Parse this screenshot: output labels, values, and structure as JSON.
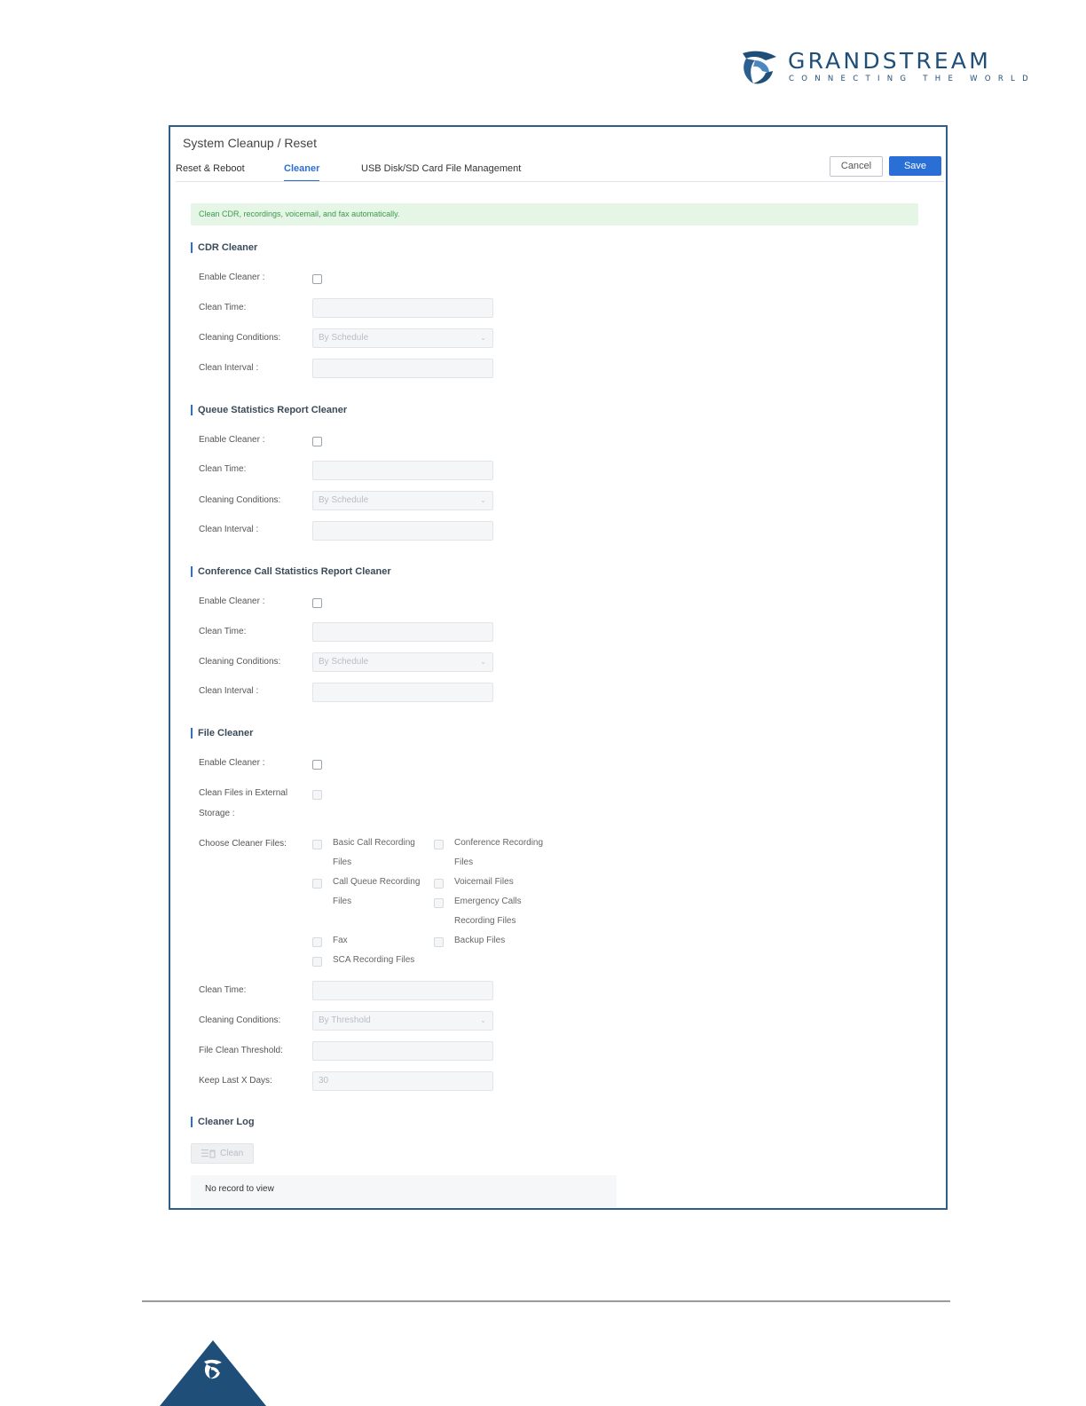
{
  "brand": {
    "name": "GRANDSTREAM",
    "tagline": "CONNECTING THE WORLD",
    "colors": {
      "primary": "#1f4e79",
      "accent": "#2a6fd6"
    }
  },
  "page": {
    "title": "System Cleanup / Reset",
    "tabs": [
      {
        "label": "Reset & Reboot",
        "active": false
      },
      {
        "label": "Cleaner",
        "active": true
      },
      {
        "label": "USB Disk/SD Card File Management",
        "active": false
      }
    ],
    "buttons": {
      "cancel": "Cancel",
      "save": "Save"
    },
    "info": "Clean CDR, recordings, voicemail, and fax automatically."
  },
  "sections": {
    "cdr": {
      "title": "CDR Cleaner",
      "enable_label": "Enable Cleaner :",
      "clean_time_label": "Clean Time:",
      "conditions_label": "Cleaning Conditions:",
      "conditions_value": "By Schedule",
      "interval_label": "Clean Interval :"
    },
    "queue": {
      "title": "Queue Statistics Report Cleaner",
      "enable_label": "Enable Cleaner :",
      "clean_time_label": "Clean Time:",
      "conditions_label": "Cleaning Conditions:",
      "conditions_value": "By Schedule",
      "interval_label": "Clean Interval :"
    },
    "conference": {
      "title": "Conference Call Statistics Report Cleaner",
      "enable_label": "Enable Cleaner :",
      "clean_time_label": "Clean Time:",
      "conditions_label": "Cleaning Conditions:",
      "conditions_value": "By Schedule",
      "interval_label": "Clean Interval :"
    },
    "file": {
      "title": "File Cleaner",
      "enable_label": "Enable Cleaner :",
      "external_label_1": "Clean Files in External",
      "external_label_2": "Storage :",
      "choose_label": "Choose Cleaner Files:",
      "options": {
        "basic_1": "Basic Call Recording",
        "basic_2": "Files",
        "conf_1": "Conference Recording",
        "conf_2": "Files",
        "queue_1": "Call Queue Recording",
        "queue_2": "Files",
        "voicemail": "Voicemail Files",
        "emerg_1": "Emergency Calls",
        "emerg_2": "Recording Files",
        "fax": "Fax",
        "backup": "Backup Files",
        "sca": "SCA Recording Files"
      },
      "clean_time_label": "Clean Time:",
      "conditions_label": "Cleaning Conditions:",
      "conditions_value": "By Threshold",
      "threshold_label": "File Clean Threshold:",
      "keep_days_label": "Keep Last X Days:",
      "keep_days_value": "30"
    },
    "log": {
      "title": "Cleaner Log",
      "clean_button": "Clean",
      "empty_text": "No record to view"
    }
  }
}
